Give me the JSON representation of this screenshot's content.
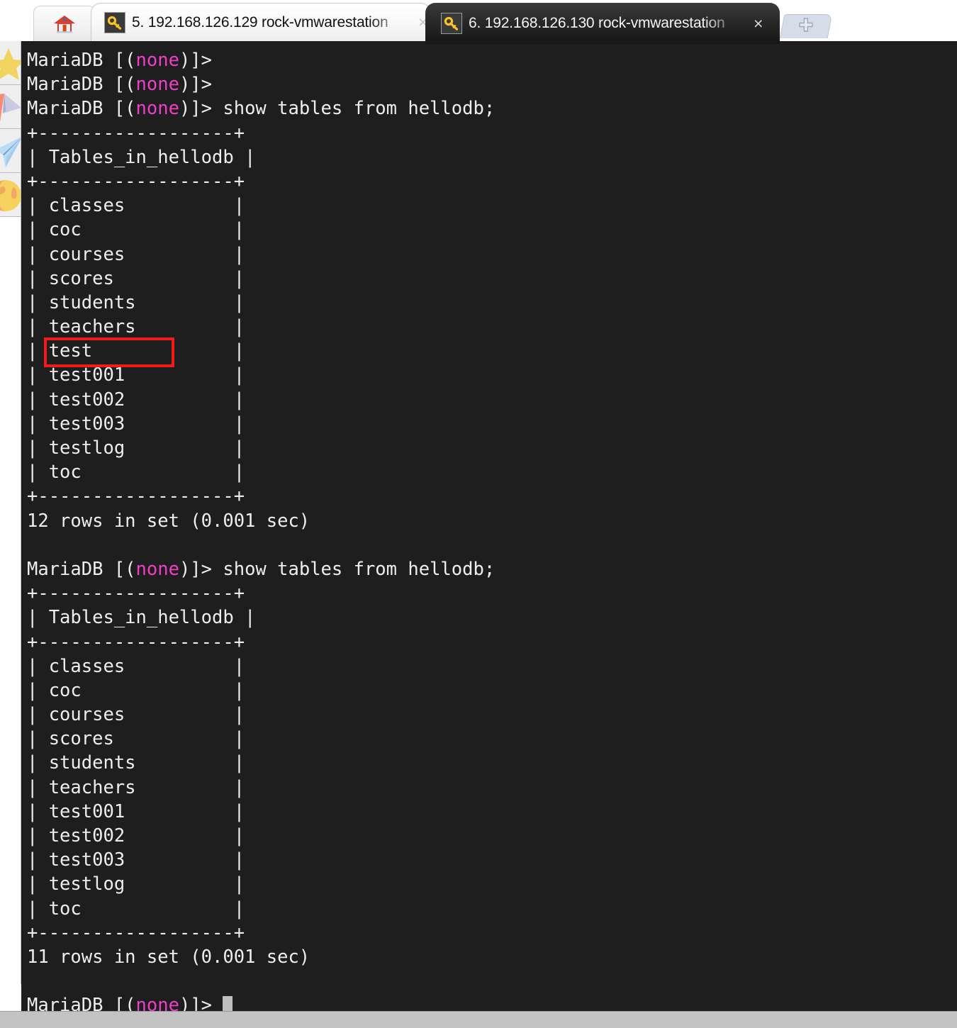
{
  "window": {
    "accent_color": "#f21b1b",
    "terminal_bg": "#1e1e1e",
    "terminal_fg": "#eeeeee",
    "prompt_db_color": "#f03ec8"
  },
  "tabbar": {
    "home_tab": {
      "icon": "home-icon",
      "label": ""
    },
    "new_tab": {
      "icon": "plus-icon",
      "label": "+"
    },
    "tabs": [
      {
        "icon": "key-icon",
        "index": "5.",
        "host": "192.168.126.129",
        "name": "rock-vmwarestation",
        "label": "5. 192.168.126.129 rock-vmwarestation",
        "close_label": "×",
        "active": false
      },
      {
        "icon": "key-icon",
        "index": "6.",
        "host": "192.168.126.130",
        "name": "rock-vmwarestation",
        "label": "6. 192.168.126.130 rock-vmwarestation",
        "close_label": "×",
        "active": true
      }
    ]
  },
  "sidebar": {
    "items": [
      {
        "icon": "star-icon",
        "label": ""
      },
      {
        "icon": "pink-plane-icon",
        "label": ""
      },
      {
        "icon": "blue-plane-icon",
        "label": ""
      },
      {
        "icon": "globe-icon",
        "label": ""
      }
    ]
  },
  "terminal": {
    "prompt_prefix": "MariaDB [(",
    "prompt_db": "none",
    "prompt_suffix": ")]> ",
    "command": "show tables from hellodb;",
    "table_border": "+------------------+",
    "table_header": "| Tables_in_hellodb |",
    "result_1": {
      "rows": [
        "classes",
        "coc",
        "courses",
        "scores",
        "students",
        "teachers",
        "test",
        "test001",
        "test002",
        "test003",
        "testlog",
        "toc"
      ],
      "status": "12 rows in set (0.001 sec)"
    },
    "result_2": {
      "rows": [
        "classes",
        "coc",
        "courses",
        "scores",
        "students",
        "teachers",
        "test001",
        "test002",
        "test003",
        "testlog",
        "toc"
      ],
      "status": "11 rows in set (0.001 sec)"
    },
    "highlighted_row": "test",
    "cursor_visible": true,
    "lines": [
      {
        "t": "prompt_only"
      },
      {
        "t": "prompt_only"
      },
      {
        "t": "prompt_cmd"
      },
      {
        "t": "text",
        "v": "+------------------+"
      },
      {
        "t": "text",
        "v": "| Tables_in_hellodb |"
      },
      {
        "t": "text",
        "v": "+------------------+"
      },
      {
        "t": "text",
        "v": "| classes          |"
      },
      {
        "t": "text",
        "v": "| coc              |"
      },
      {
        "t": "text",
        "v": "| courses          |"
      },
      {
        "t": "text",
        "v": "| scores           |"
      },
      {
        "t": "text",
        "v": "| students         |"
      },
      {
        "t": "text",
        "v": "| teachers         |"
      },
      {
        "t": "text",
        "v": "| test             |"
      },
      {
        "t": "text",
        "v": "| test001          |"
      },
      {
        "t": "text",
        "v": "| test002          |"
      },
      {
        "t": "text",
        "v": "| test003          |"
      },
      {
        "t": "text",
        "v": "| testlog          |"
      },
      {
        "t": "text",
        "v": "| toc              |"
      },
      {
        "t": "text",
        "v": "+------------------+"
      },
      {
        "t": "text",
        "v": "12 rows in set (0.001 sec)"
      },
      {
        "t": "text",
        "v": ""
      },
      {
        "t": "prompt_cmd"
      },
      {
        "t": "text",
        "v": "+------------------+"
      },
      {
        "t": "text",
        "v": "| Tables_in_hellodb |"
      },
      {
        "t": "text",
        "v": "+------------------+"
      },
      {
        "t": "text",
        "v": "| classes          |"
      },
      {
        "t": "text",
        "v": "| coc              |"
      },
      {
        "t": "text",
        "v": "| courses          |"
      },
      {
        "t": "text",
        "v": "| scores           |"
      },
      {
        "t": "text",
        "v": "| students         |"
      },
      {
        "t": "text",
        "v": "| teachers         |"
      },
      {
        "t": "text",
        "v": "| test001          |"
      },
      {
        "t": "text",
        "v": "| test002          |"
      },
      {
        "t": "text",
        "v": "| test003          |"
      },
      {
        "t": "text",
        "v": "| testlog          |"
      },
      {
        "t": "text",
        "v": "| toc              |"
      },
      {
        "t": "text",
        "v": "+------------------+"
      },
      {
        "t": "text",
        "v": "11 rows in set (0.001 sec)"
      },
      {
        "t": "text",
        "v": ""
      },
      {
        "t": "prompt_cursor"
      }
    ]
  }
}
